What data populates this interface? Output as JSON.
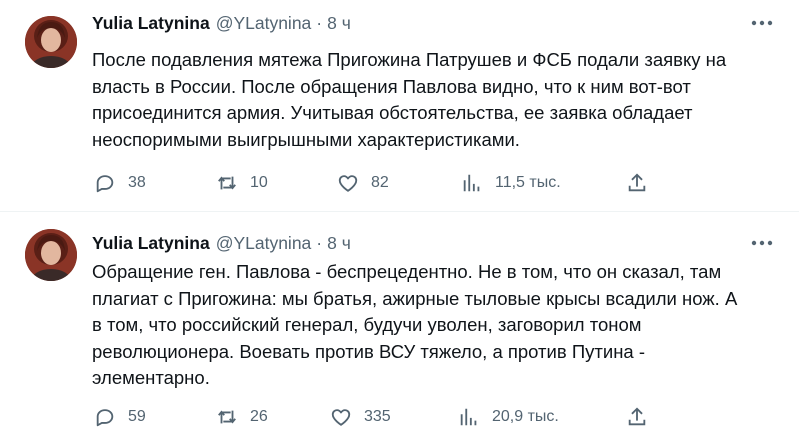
{
  "tweets": [
    {
      "author": {
        "name": "Yulia Latynina",
        "handle": "@YLatynina"
      },
      "separator": "·",
      "time": "8 ч",
      "text_lines": [
        "После подавления мятежа Пригожина Патрушев и ФСБ подали заявку на",
        "власть в России. После обращения Павлова видно, что к ним вот-вот",
        "присоединится армия. Учитывая обстоятельства, ее заявка обладает",
        "неоспоримыми выигрышными характеристиками."
      ],
      "replies": "38",
      "reposts": "10",
      "likes": "82",
      "views": "11,5 тыс.",
      "icons": {
        "reply": "reply-icon",
        "repost": "repost-icon",
        "like": "like-icon",
        "views": "views-icon",
        "share": "share-icon",
        "more": "more-icon"
      }
    },
    {
      "author": {
        "name": "Yulia Latynina",
        "handle": "@YLatynina"
      },
      "separator": "·",
      "time": "8 ч",
      "text_lines": [
        "Обращение ген. Павлова - беспрецедентно. Не в том, что он сказал, там",
        "плагиат с Пригожина: мы братья, ажирные тыловые крысы всадили нож. А",
        "в том, что российский генерал, будучи уволен, заговорил тоном",
        "революционера. Воевать против ВСУ тяжело, а против Путина -",
        "элементарно."
      ],
      "replies": "59",
      "reposts": "26",
      "likes": "335",
      "views": "20,9 тыс.",
      "icons": {
        "reply": "reply-icon",
        "repost": "repost-icon",
        "like": "like-icon",
        "views": "views-icon",
        "share": "share-icon",
        "more": "more-icon"
      }
    }
  ],
  "colors": {
    "text": "#0f1419",
    "secondary": "#536471",
    "divider": "#eff3f4"
  }
}
